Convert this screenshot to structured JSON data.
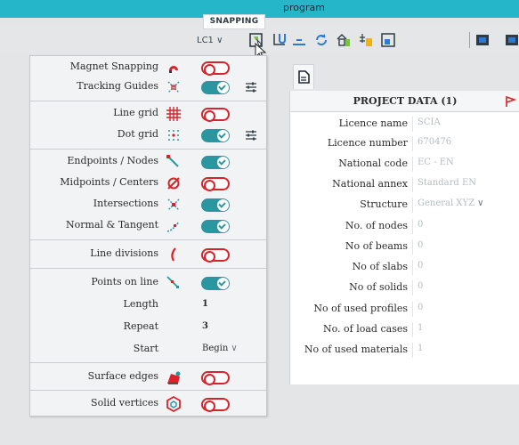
{
  "header": {
    "program": "program"
  },
  "tooltip": {
    "label": "SNAPPING"
  },
  "toolbar": {
    "load_case": "LC1",
    "load_case_chevron": "∨"
  },
  "colors": {
    "accent": "#2b96a0",
    "off_red": "#d8232a",
    "topbar": "#25b6c9"
  },
  "snapping": {
    "magnet": {
      "label": "Magnet Snapping",
      "state": "off",
      "icon": "magnet-icon"
    },
    "tracking": {
      "label": "Tracking Guides",
      "state": "on",
      "icon": "tracking-guides-icon"
    },
    "line_grid": {
      "label": "Line grid",
      "state": "off",
      "icon": "line-grid-icon"
    },
    "dot_grid": {
      "label": "Dot grid",
      "state": "on",
      "icon": "dot-grid-icon"
    },
    "endpoints": {
      "label": "Endpoints / Nodes",
      "state": "on",
      "icon": "endpoints-icon"
    },
    "midpoints": {
      "label": "Midpoints / Centers",
      "state": "off",
      "icon": "midpoints-icon"
    },
    "intersections": {
      "label": "Intersections",
      "state": "on",
      "icon": "intersections-icon"
    },
    "normal": {
      "label": "Normal & Tangent",
      "state": "on",
      "icon": "normal-tangent-icon"
    },
    "line_divisions": {
      "label": "Line divisions",
      "state": "off",
      "icon": "line-divisions-icon"
    },
    "points_on_line": {
      "label": "Points on line",
      "state": "on",
      "icon": "points-on-line-icon"
    },
    "length": {
      "label": "Length",
      "value": "1"
    },
    "repeat": {
      "label": "Repeat",
      "value": "3"
    },
    "start": {
      "label": "Start",
      "value": "Begin",
      "chevron": "∨"
    },
    "surface_edges": {
      "label": "Surface edges",
      "state": "off",
      "icon": "surface-edges-icon"
    },
    "solid_vertices": {
      "label": "Solid vertices",
      "state": "off",
      "icon": "solid-vertices-icon"
    }
  },
  "project_data": {
    "title": "PROJECT DATA (1)",
    "rows": [
      {
        "key": "Licence name",
        "value": "SCIA"
      },
      {
        "key": "Licence number",
        "value": "670476"
      },
      {
        "key": "National code",
        "value": "EC - EN"
      },
      {
        "key": "National annex",
        "value": "Standard EN"
      },
      {
        "key": "Structure",
        "value": "General XYZ",
        "chevron": "∨"
      },
      {
        "key": "No. of nodes",
        "value": "0"
      },
      {
        "key": "No of beams",
        "value": "0"
      },
      {
        "key": "No of slabs",
        "value": "0"
      },
      {
        "key": "No of solids",
        "value": "0"
      },
      {
        "key": "No of used profiles",
        "value": "0"
      },
      {
        "key": "No. of load cases",
        "value": "1"
      },
      {
        "key": "No of used materials",
        "value": "1"
      }
    ]
  }
}
